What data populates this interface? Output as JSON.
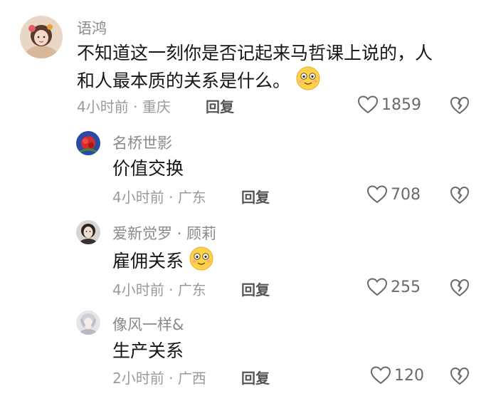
{
  "comments": [
    {
      "username": "语鸿",
      "text_line1": "不知道这一刻你是否记起来马哲课上说的，人",
      "text_line2": "和人最本质的关系是什么。",
      "time": "4小时前",
      "location": "重庆",
      "reply_label": "回复",
      "likes": "1859",
      "emoji": "smiling-face-emoji"
    }
  ],
  "replies": [
    {
      "username": "名桥世影",
      "text": "价值交换",
      "time": "4小时前",
      "location": "广东",
      "reply_label": "回复",
      "likes": "708"
    },
    {
      "username": "爱新觉罗 · 顾莉",
      "text": "雇佣关系",
      "time": "4小时前",
      "location": "广东",
      "reply_label": "回复",
      "likes": "255",
      "emoji": "smiling-face-emoji"
    },
    {
      "username": "像风一样&",
      "text": "生产关系",
      "time": "2小时前",
      "location": "广西",
      "reply_label": "回复",
      "likes": "120"
    }
  ],
  "separator": " · ",
  "colors": {
    "text": "#161616",
    "meta": "#9a9a9a",
    "username": "#8a8a8a"
  }
}
